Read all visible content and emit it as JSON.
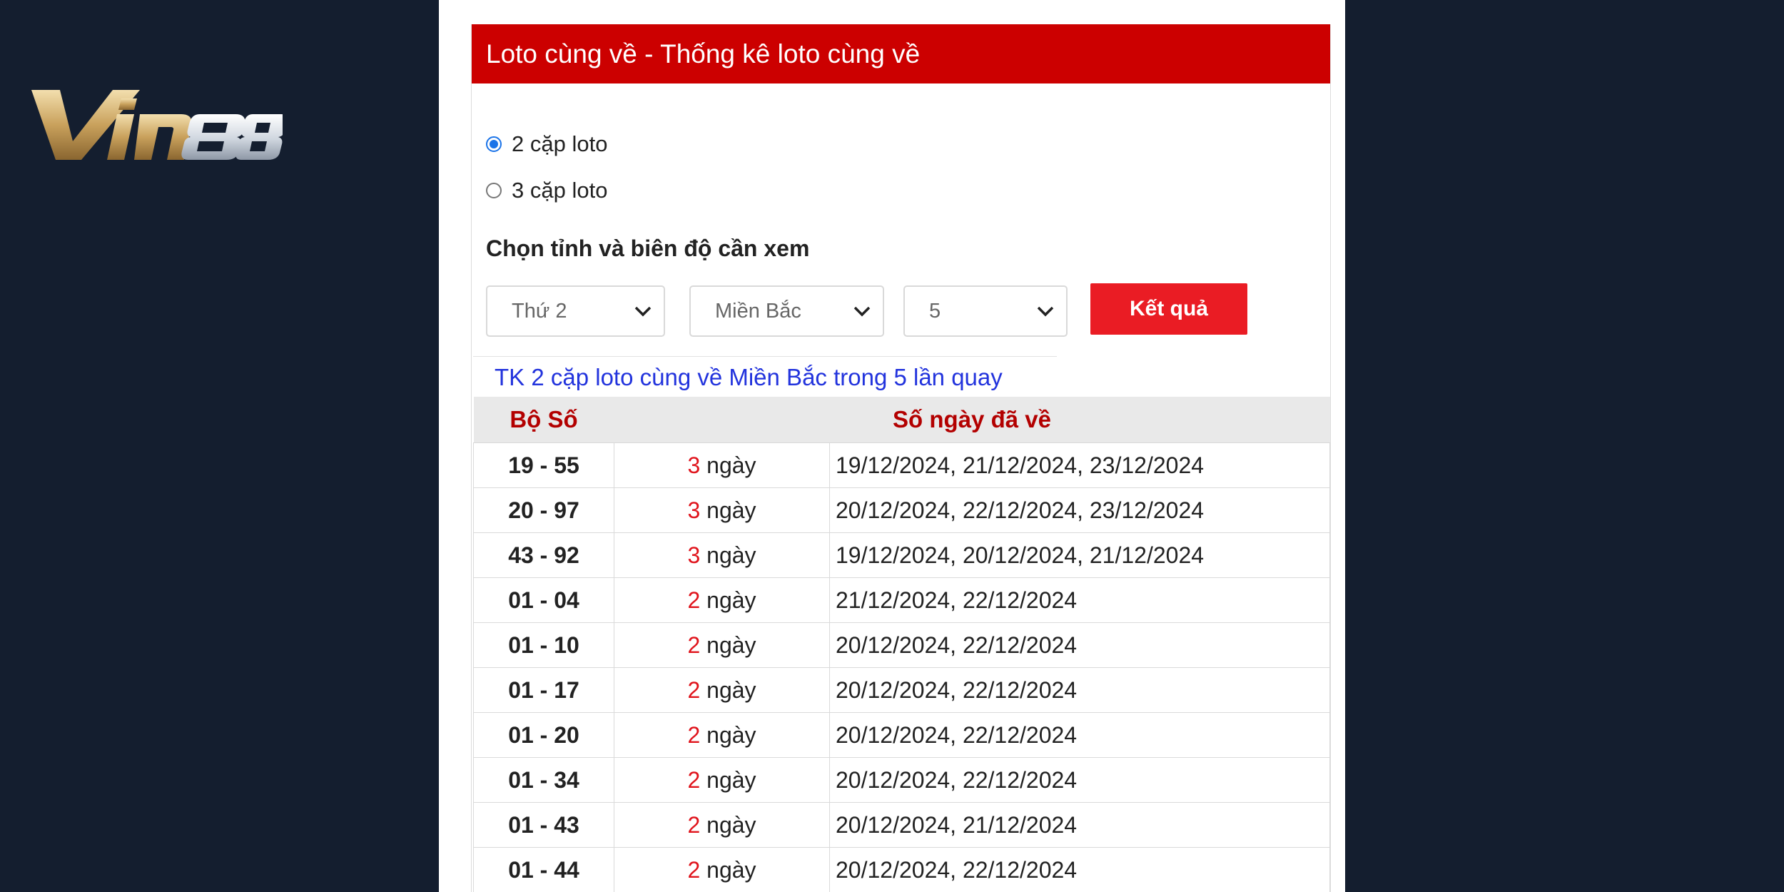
{
  "logo": {
    "text": "Vin88"
  },
  "colors": {
    "background": "#141e2f",
    "header": "#cc0000",
    "button": "#ea1c24",
    "link": "#2233dd",
    "table_header_text": "#b30000"
  },
  "widget": {
    "title": "Loto cùng về - Thống kê loto cùng về",
    "radios": [
      {
        "label": "2 cặp loto",
        "checked": true
      },
      {
        "label": "3 cặp loto",
        "checked": false
      }
    ],
    "section_label": "Chọn tỉnh và biên độ cần xem",
    "selects": {
      "day": "Thứ 2",
      "region": "Miền Bắc",
      "range": "5"
    },
    "submit_label": "Kết quả",
    "result_title": "TK 2 cặp loto cùng về Miền Bắc trong 5 lần quay"
  },
  "table": {
    "headers": {
      "pair": "Bộ Số",
      "days": "Số ngày đã về"
    },
    "unit": "ngày",
    "rows": [
      {
        "pair": "19 - 55",
        "count": "3",
        "dates": "19/12/2024, 21/12/2024, 23/12/2024"
      },
      {
        "pair": "20 - 97",
        "count": "3",
        "dates": "20/12/2024, 22/12/2024, 23/12/2024"
      },
      {
        "pair": "43 - 92",
        "count": "3",
        "dates": "19/12/2024, 20/12/2024, 21/12/2024"
      },
      {
        "pair": "01 - 04",
        "count": "2",
        "dates": "21/12/2024, 22/12/2024"
      },
      {
        "pair": "01 - 10",
        "count": "2",
        "dates": "20/12/2024, 22/12/2024"
      },
      {
        "pair": "01 - 17",
        "count": "2",
        "dates": "20/12/2024, 22/12/2024"
      },
      {
        "pair": "01 - 20",
        "count": "2",
        "dates": "20/12/2024, 22/12/2024"
      },
      {
        "pair": "01 - 34",
        "count": "2",
        "dates": "20/12/2024, 22/12/2024"
      },
      {
        "pair": "01 - 43",
        "count": "2",
        "dates": "20/12/2024, 21/12/2024"
      },
      {
        "pair": "01 - 44",
        "count": "2",
        "dates": "20/12/2024, 22/12/2024"
      }
    ]
  }
}
